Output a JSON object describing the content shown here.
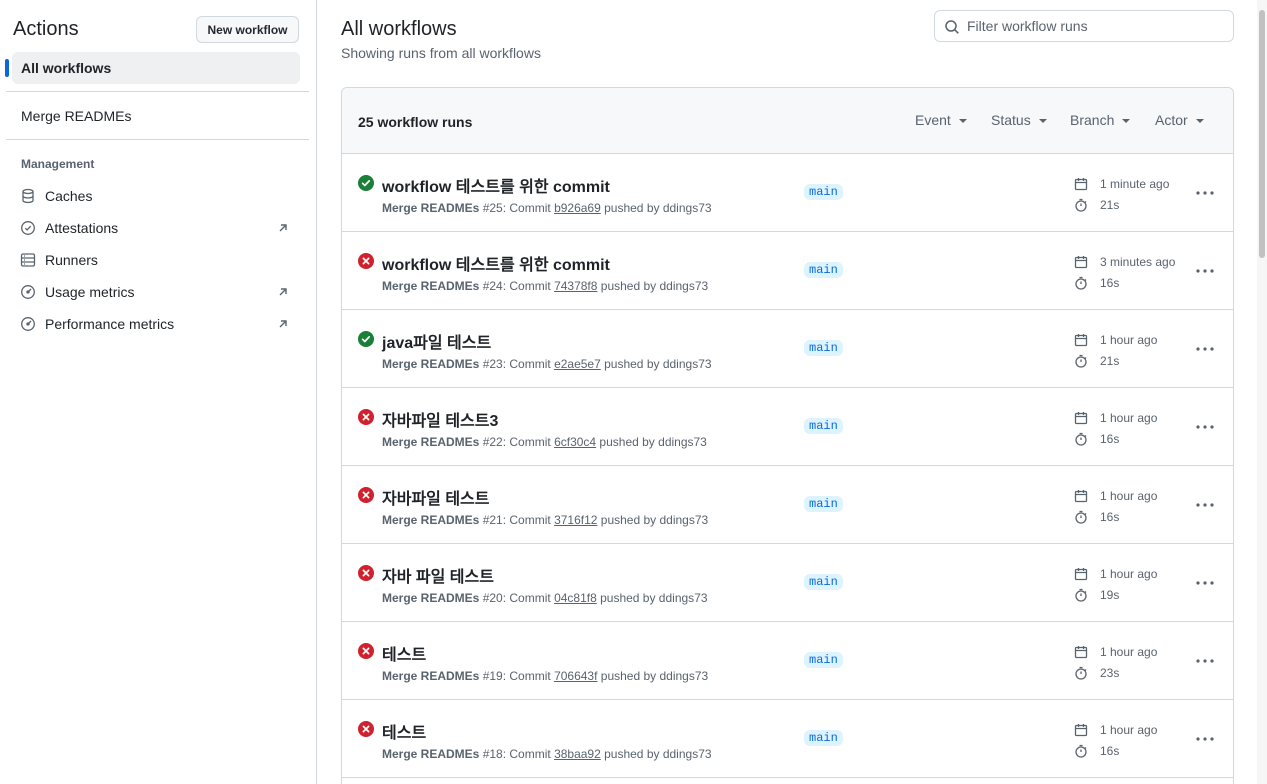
{
  "sidebar": {
    "title": "Actions",
    "new_workflow_label": "New workflow",
    "all_workflows_label": "All workflows",
    "workflows": [
      "Merge READMEs"
    ],
    "management_label": "Management",
    "management_items": [
      {
        "label": "Caches",
        "icon": "cache-icon",
        "external": false
      },
      {
        "label": "Attestations",
        "icon": "attestation-icon",
        "external": true
      },
      {
        "label": "Runners",
        "icon": "runner-icon",
        "external": false
      },
      {
        "label": "Usage metrics",
        "icon": "usage-metrics-icon",
        "external": true
      },
      {
        "label": "Performance metrics",
        "icon": "performance-metrics-icon",
        "external": true
      }
    ]
  },
  "main": {
    "title": "All workflows",
    "subtitle": "Showing runs from all workflows",
    "filter_placeholder": "Filter workflow runs",
    "run_count": "25 workflow runs",
    "filters": [
      "Event",
      "Status",
      "Branch",
      "Actor"
    ]
  },
  "colors": {
    "success": "#1a7f37",
    "failure": "#cf222e",
    "accent": "#0969da"
  },
  "runs": [
    {
      "status": "success",
      "title": "workflow 테스트를 위한 commit",
      "workflow": "Merge READMEs",
      "meta_mid": " #25: Commit ",
      "sha": "b926a69",
      "meta_end": " pushed by ddings73",
      "branch": "main",
      "time": "1 minute ago",
      "duration": "21s"
    },
    {
      "status": "failure",
      "title": "workflow 테스트를 위한 commit",
      "workflow": "Merge READMEs",
      "meta_mid": " #24: Commit ",
      "sha": "74378f8",
      "meta_end": " pushed by ddings73",
      "branch": "main",
      "time": "3 minutes ago",
      "duration": "16s"
    },
    {
      "status": "success",
      "title": "java파일 테스트",
      "workflow": "Merge READMEs",
      "meta_mid": " #23: Commit ",
      "sha": "e2ae5e7",
      "meta_end": " pushed by ddings73",
      "branch": "main",
      "time": "1 hour ago",
      "duration": "21s"
    },
    {
      "status": "failure",
      "title": "자바파일 테스트3",
      "workflow": "Merge READMEs",
      "meta_mid": " #22: Commit ",
      "sha": "6cf30c4",
      "meta_end": " pushed by ddings73",
      "branch": "main",
      "time": "1 hour ago",
      "duration": "16s"
    },
    {
      "status": "failure",
      "title": "자바파일 테스트",
      "workflow": "Merge READMEs",
      "meta_mid": " #21: Commit ",
      "sha": "3716f12",
      "meta_end": " pushed by ddings73",
      "branch": "main",
      "time": "1 hour ago",
      "duration": "16s"
    },
    {
      "status": "failure",
      "title": "자바 파일 테스트",
      "workflow": "Merge READMEs",
      "meta_mid": " #20: Commit ",
      "sha": "04c81f8",
      "meta_end": " pushed by ddings73",
      "branch": "main",
      "time": "1 hour ago",
      "duration": "19s"
    },
    {
      "status": "failure",
      "title": "테스트",
      "workflow": "Merge READMEs",
      "meta_mid": " #19: Commit ",
      "sha": "706643f",
      "meta_end": " pushed by ddings73",
      "branch": "main",
      "time": "1 hour ago",
      "duration": "23s"
    },
    {
      "status": "failure",
      "title": "테스트",
      "workflow": "Merge READMEs",
      "meta_mid": " #18: Commit ",
      "sha": "38baa92",
      "meta_end": " pushed by ddings73",
      "branch": "main",
      "time": "1 hour ago",
      "duration": "16s"
    }
  ]
}
